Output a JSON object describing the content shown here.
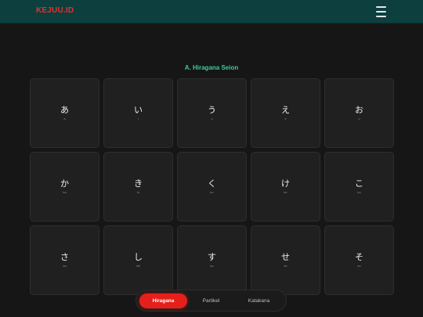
{
  "header": {
    "logo_text": "KEJUU.ID",
    "menu_icon": "hamburger-icon"
  },
  "section": {
    "title": "A. Hiragana Seion"
  },
  "cards": [
    {
      "kana": "あ",
      "romaji": "a"
    },
    {
      "kana": "い",
      "romaji": "i"
    },
    {
      "kana": "う",
      "romaji": "u"
    },
    {
      "kana": "え",
      "romaji": "e"
    },
    {
      "kana": "お",
      "romaji": "o"
    },
    {
      "kana": "か",
      "romaji": "ka"
    },
    {
      "kana": "き",
      "romaji": "ki"
    },
    {
      "kana": "く",
      "romaji": "ku"
    },
    {
      "kana": "け",
      "romaji": "ke"
    },
    {
      "kana": "こ",
      "romaji": "ko"
    },
    {
      "kana": "さ",
      "romaji": "sa"
    },
    {
      "kana": "し",
      "romaji": "shi"
    },
    {
      "kana": "す",
      "romaji": "su"
    },
    {
      "kana": "せ",
      "romaji": "se"
    },
    {
      "kana": "そ",
      "romaji": "so"
    }
  ],
  "tabs": [
    {
      "label": "Hiragana",
      "active": true
    },
    {
      "label": "Partikel",
      "active": false
    },
    {
      "label": "Katakana",
      "active": false
    }
  ],
  "colors": {
    "accent": "#e5201b",
    "header_bg": "#0d3f3f",
    "title": "#3fcaa0"
  }
}
